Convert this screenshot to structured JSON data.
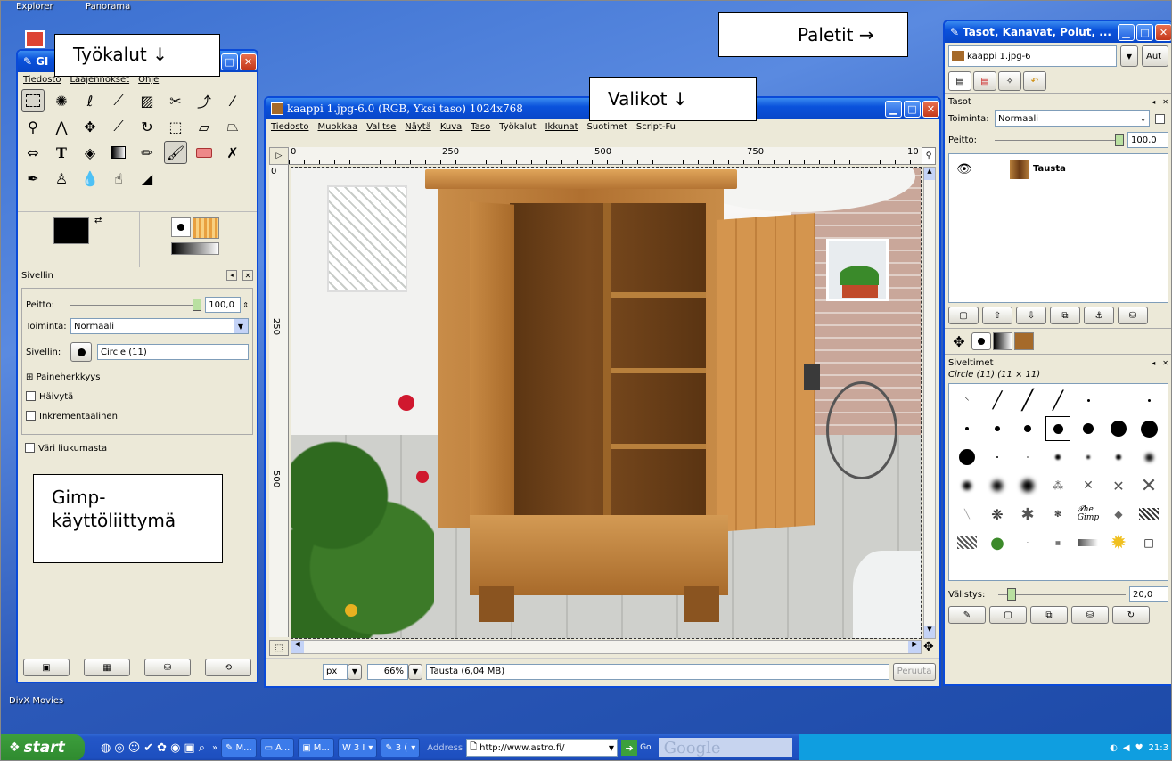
{
  "desktop": {
    "label_top_left_1": "Explorer",
    "label_top_left_2": "Panorama",
    "label_bottom": "DivX Movies"
  },
  "callouts": {
    "tools": "Työkalut ↓",
    "palettes": "Paletit →",
    "menus": "Valikot ↓",
    "ui": "Gimp-\nkäyttöliittymä"
  },
  "toolbox": {
    "title": "GI",
    "menu": [
      "Tiedosto",
      "Laajennokset",
      "Ohje"
    ],
    "brush_panel_title": "Sivellin",
    "opacity_label": "Peitto:",
    "opacity_value": "100,0",
    "mode_label": "Toiminta:",
    "mode_value": "Normaali",
    "brush_label": "Sivellin:",
    "brush_value": "Circle (11)",
    "pressure": "Paineherkkyys",
    "fade": "Häivytä",
    "incremental": "Inkrementaalinen",
    "gradient_color": "Väri liukumasta"
  },
  "image_window": {
    "title": "kaappi 1.jpg-6.0 (RGB, Yksi taso) 1024x768",
    "menu": [
      "Tiedosto",
      "Muokkaa",
      "Valitse",
      "Näytä",
      "Kuva",
      "Taso",
      "Työkalut",
      "Ikkunat",
      "Suotimet",
      "Script-Fu"
    ],
    "ruler_ticks": [
      "0",
      "250",
      "500",
      "750",
      "10"
    ],
    "vruler_ticks": [
      "0",
      "250",
      "500"
    ],
    "unit": "px",
    "zoom": "66%",
    "status": "Tausta (6,04 MB)",
    "cancel": "Peruuta"
  },
  "dock": {
    "title": "Tasot, Kanavat, Polut, ...",
    "image_select": "kaappi 1.jpg-6",
    "auto": "Aut",
    "layers_title": "Tasot",
    "mode_label": "Toiminta:",
    "mode_value": "Normaali",
    "opacity_label": "Peitto:",
    "opacity_value": "100,0",
    "layer_name": "Tausta",
    "brushes_title": "Siveltimet",
    "brush_info": "Circle (11) (11 × 11)",
    "spacing_label": "Välistys:",
    "spacing_value": "20,0"
  },
  "taskbar": {
    "start": "start",
    "items": [
      "M...",
      "A...",
      "M...",
      "3 I",
      "3 ("
    ],
    "address_label": "Address",
    "address_value": "http://www.astro.fi/",
    "go": "Go",
    "search_logo": "Google",
    "clock": "21:3"
  }
}
